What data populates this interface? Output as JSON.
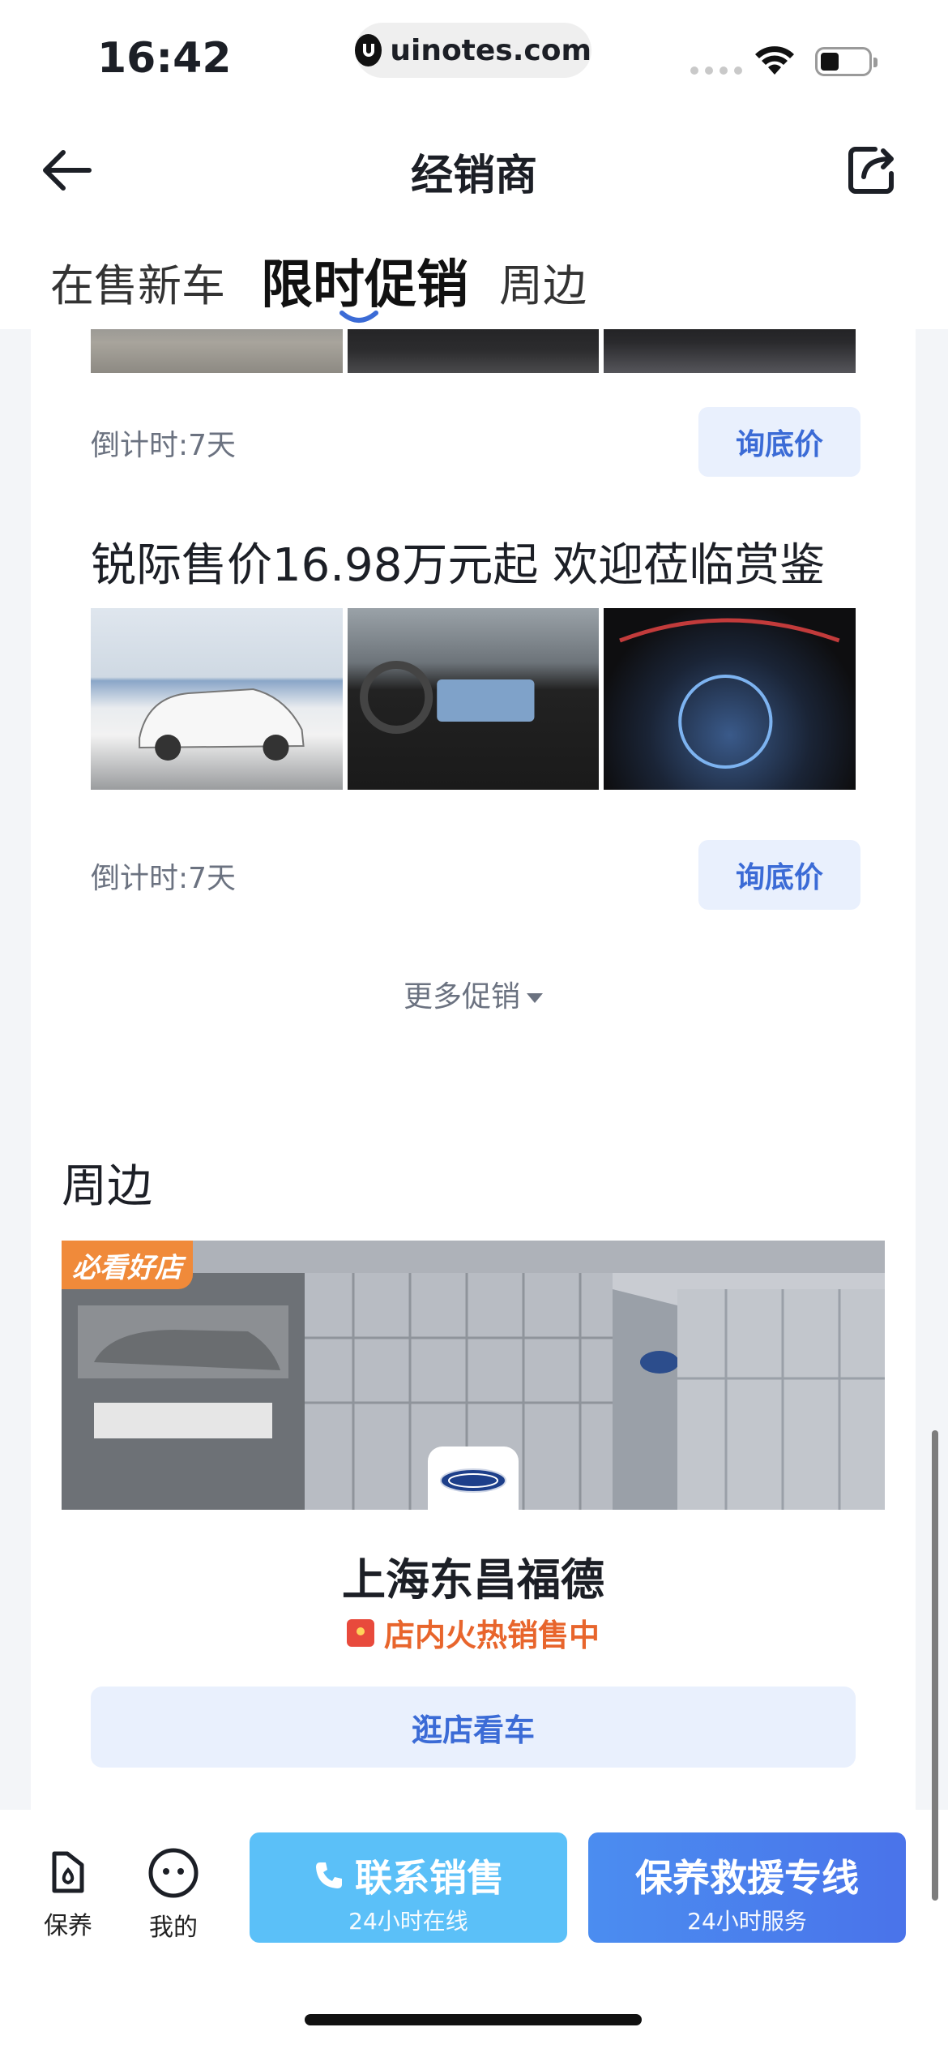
{
  "status_bar": {
    "time": "16:42",
    "url": "uinotes.com"
  },
  "nav": {
    "title": "经销商"
  },
  "tabs": [
    {
      "label": "在售新车",
      "active": false
    },
    {
      "label": "限时促销",
      "active": true
    },
    {
      "label": "周边",
      "active": false
    }
  ],
  "promotions": [
    {
      "title": "",
      "countdown": "倒计时:7天",
      "button": "询底价"
    },
    {
      "title": "锐际售价16.98万元起 欢迎莅临赏鉴",
      "countdown": "倒计时:7天",
      "button": "询底价"
    }
  ],
  "more_promos": "更多促销",
  "nearby": {
    "section_title": "周边",
    "badge": "必看好店",
    "store_name": "上海东昌福德",
    "hot_sale": "店内火热销售中",
    "visit_button": "逛店看车"
  },
  "bottom_bar": {
    "maintain_label": "保养",
    "mine_label": "我的",
    "contact": {
      "title": "联系销售",
      "subtitle": "24小时在线"
    },
    "rescue": {
      "title": "保养救援专线",
      "subtitle": "24小时服务"
    }
  },
  "colors": {
    "accent": "#3b6bd6",
    "contact_btn": "#5bc0f8",
    "rescue_btn": "#4a73ea",
    "hot": "#e8652c"
  }
}
